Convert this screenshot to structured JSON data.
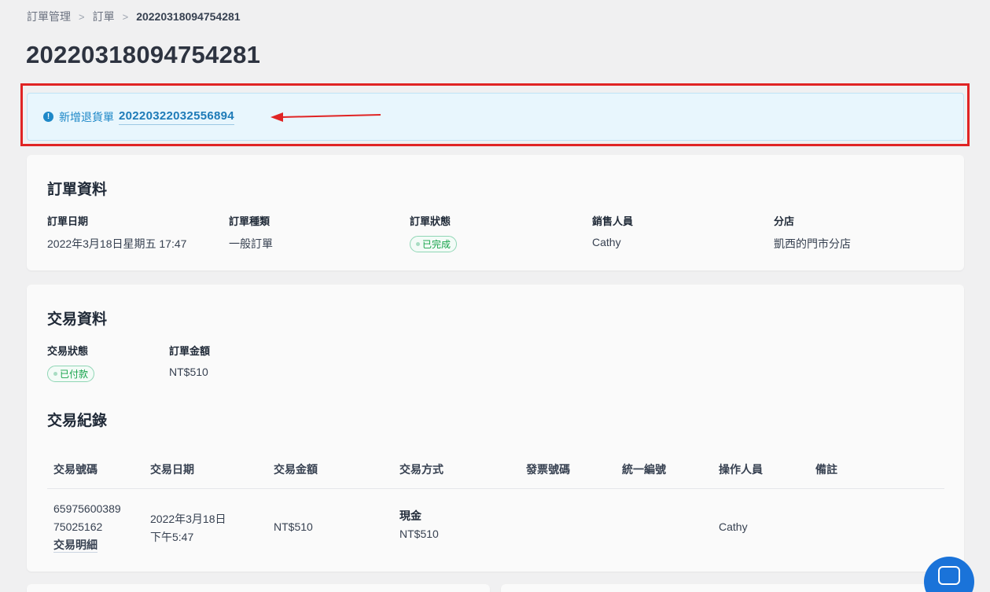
{
  "breadcrumb": {
    "items": [
      "訂單管理",
      "訂單",
      "20220318094754281"
    ]
  },
  "page_title": "20220318094754281",
  "notice": {
    "icon": "exclamation-circle-icon",
    "label": "新增退貨單",
    "link": "20220322032556894"
  },
  "order_info": {
    "title": "訂單資料",
    "fields": [
      {
        "label": "訂單日期",
        "value": "2022年3月18日星期五 17:47"
      },
      {
        "label": "訂單種類",
        "value": "一般訂單"
      },
      {
        "label": "訂單狀態",
        "value": "已完成"
      },
      {
        "label": "銷售人員",
        "value": "Cathy"
      },
      {
        "label": "分店",
        "value": "凱西的門市分店"
      }
    ]
  },
  "transaction_info": {
    "title": "交易資料",
    "fields": [
      {
        "label": "交易狀態",
        "value": "已付款"
      },
      {
        "label": "訂單金額",
        "value": "NT$510"
      }
    ]
  },
  "transaction_records": {
    "title": "交易紀錄",
    "columns": [
      "交易號碼",
      "交易日期",
      "交易金額",
      "交易方式",
      "發票號碼",
      "統一編號",
      "操作人員",
      "備註"
    ],
    "rows": [
      {
        "number_line1": "65975600389",
        "number_line2": "75025162",
        "detail_link": "交易明細",
        "date_line1": "2022年3月18日",
        "date_line2": "下午5:47",
        "amount": "NT$510",
        "method": "現金",
        "method_amount": "NT$510",
        "invoice": "",
        "tax_id": "",
        "operator": "Cathy",
        "note": ""
      }
    ]
  },
  "colors": {
    "accent": "#1e88c8",
    "highlight": "#e02424",
    "success": "#16a34a",
    "chat": "#1a73d9"
  }
}
